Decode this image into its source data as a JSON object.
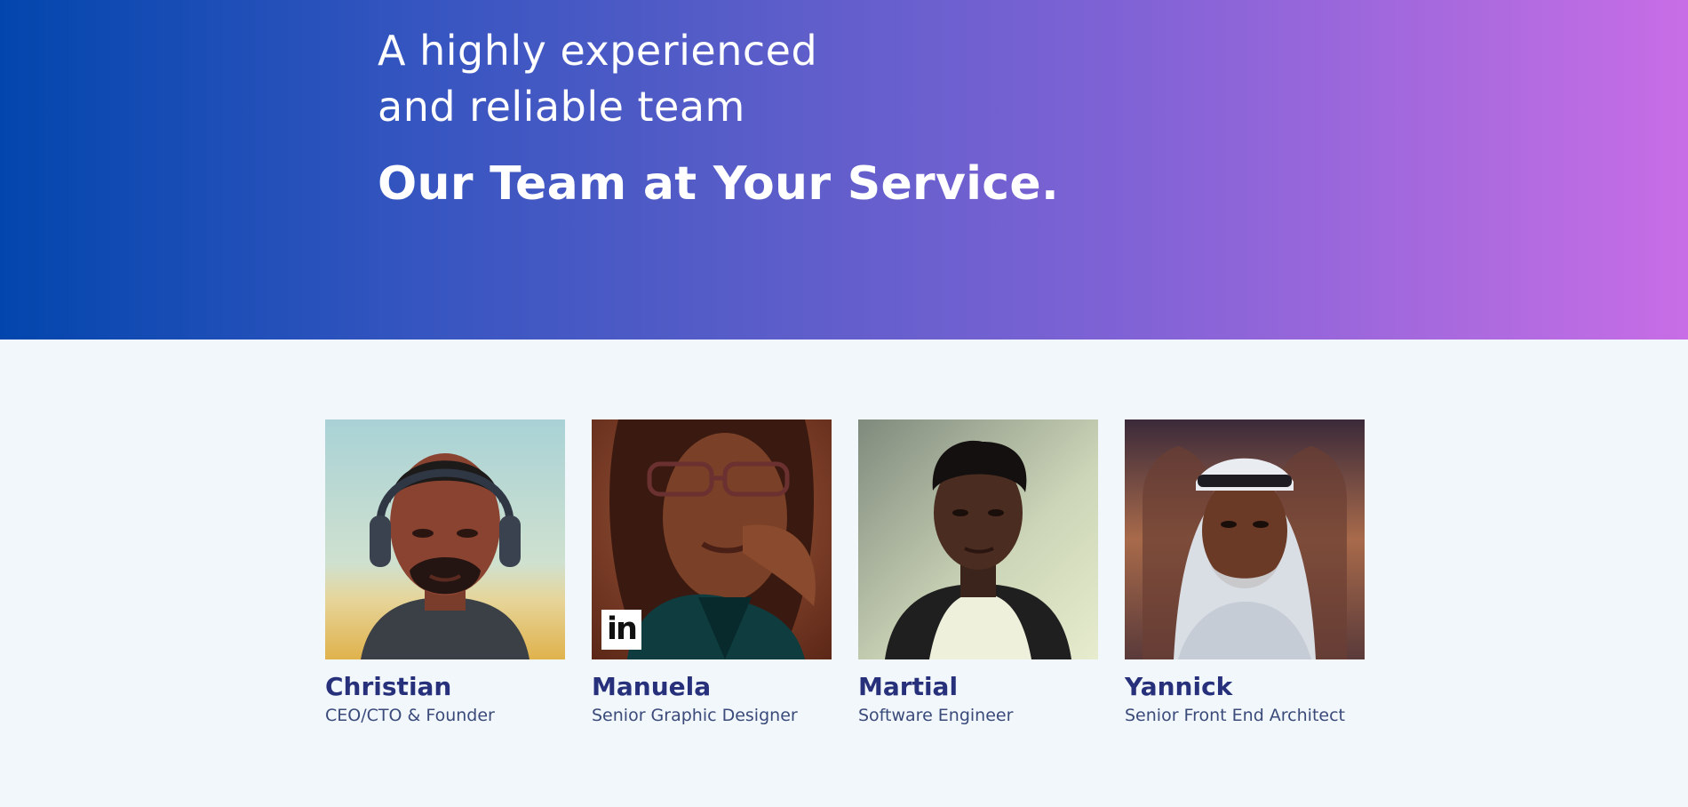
{
  "hero": {
    "subtitle_line1": "A highly experienced",
    "subtitle_line2": "and reliable team",
    "title": "Our Team at Your Service."
  },
  "team": [
    {
      "name": "Christian",
      "role": "CEO/CTO & Founder",
      "icon": "person-with-headphones"
    },
    {
      "name": "Manuela",
      "role": "Senior Graphic Designer",
      "icon": "person-with-glasses",
      "linkedin_label": "in"
    },
    {
      "name": "Martial",
      "role": "Software Engineer",
      "icon": "young-man"
    },
    {
      "name": "Yannick",
      "role": "Senior Front End Architect",
      "icon": "man-with-headdress"
    }
  ],
  "colors": {
    "gradient_start": "#0246ad",
    "gradient_end": "#c86de6",
    "name_color": "#27307a",
    "role_color": "#3a4a7a",
    "page_background": "#f1f7fb"
  }
}
